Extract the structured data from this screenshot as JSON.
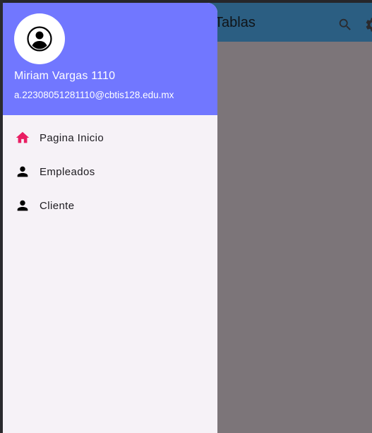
{
  "appbar": {
    "title": "Tablas",
    "search_icon": "search-icon",
    "settings_icon": "gear-icon",
    "color": "#2b5e82"
  },
  "drawer": {
    "header": {
      "name": "Miriam Vargas 1110",
      "email": "a.22308051281110@cbtis128.edu.mx",
      "avatar_icon": "account-circle-icon",
      "color": "#7177ff"
    },
    "items": [
      {
        "label": "Pagina Inicio",
        "icon": "home-icon",
        "icon_color": "#e91e63"
      },
      {
        "label": "Empleados",
        "icon": "person-icon",
        "icon_color": "#000000"
      },
      {
        "label": "Cliente",
        "icon": "person-icon",
        "icon_color": "#000000"
      }
    ],
    "background": "#f6f2f7"
  },
  "scrim_color": "#7c7579"
}
